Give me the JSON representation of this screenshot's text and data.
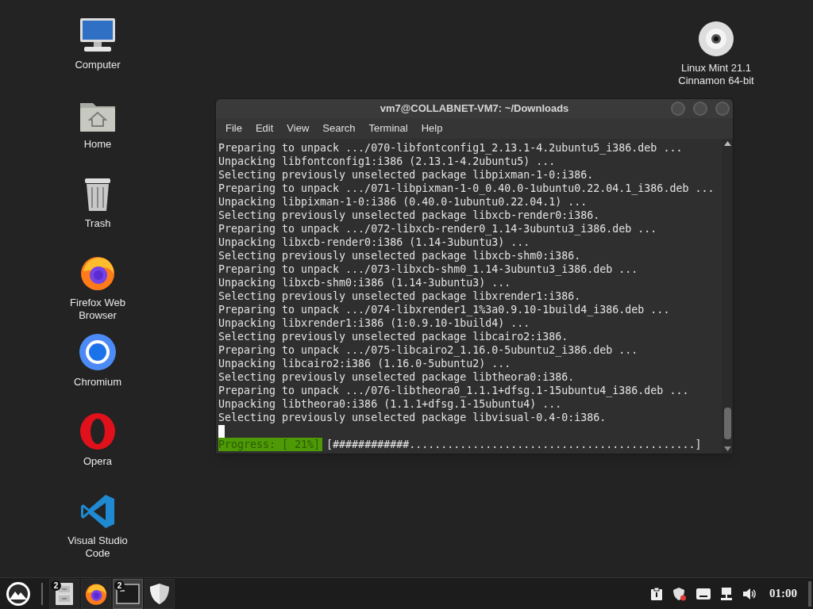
{
  "desktop_icons": [
    {
      "kind": "computer",
      "label": "Computer"
    },
    {
      "kind": "home",
      "label": "Home"
    },
    {
      "kind": "trash",
      "label": "Trash"
    },
    {
      "kind": "firefox",
      "label": "Firefox Web Browser"
    },
    {
      "kind": "chromium",
      "label": "Chromium"
    },
    {
      "kind": "opera",
      "label": "Opera"
    },
    {
      "kind": "vscode",
      "label": "Visual Studio Code"
    }
  ],
  "disc_icon": {
    "kind": "disc",
    "label": "Linux Mint 21.1 Cinnamon 64-bit"
  },
  "terminal": {
    "title": "vm7@COLLABNET-VM7: ~/Downloads",
    "menu": [
      "File",
      "Edit",
      "View",
      "Search",
      "Terminal",
      "Help"
    ],
    "lines": [
      "Preparing to unpack .../070-libfontconfig1_2.13.1-4.2ubuntu5_i386.deb ...",
      "Unpacking libfontconfig1:i386 (2.13.1-4.2ubuntu5) ...",
      "Selecting previously unselected package libpixman-1-0:i386.",
      "Preparing to unpack .../071-libpixman-1-0_0.40.0-1ubuntu0.22.04.1_i386.deb ...",
      "Unpacking libpixman-1-0:i386 (0.40.0-1ubuntu0.22.04.1) ...",
      "Selecting previously unselected package libxcb-render0:i386.",
      "Preparing to unpack .../072-libxcb-render0_1.14-3ubuntu3_i386.deb ...",
      "Unpacking libxcb-render0:i386 (1.14-3ubuntu3) ...",
      "Selecting previously unselected package libxcb-shm0:i386.",
      "Preparing to unpack .../073-libxcb-shm0_1.14-3ubuntu3_i386.deb ...",
      "Unpacking libxcb-shm0:i386 (1.14-3ubuntu3) ...",
      "Selecting previously unselected package libxrender1:i386.",
      "Preparing to unpack .../074-libxrender1_1%3a0.9.10-1build4_i386.deb ...",
      "Unpacking libxrender1:i386 (1:0.9.10-1build4) ...",
      "Selecting previously unselected package libcairo2:i386.",
      "Preparing to unpack .../075-libcairo2_1.16.0-5ubuntu2_i386.deb ...",
      "Unpacking libcairo2:i386 (1.16.0-5ubuntu2) ...",
      "Selecting previously unselected package libtheora0:i386.",
      "Preparing to unpack .../076-libtheora0_1.1.1+dfsg.1-15ubuntu4_i386.deb ...",
      "Unpacking libtheora0:i386 (1.1.1+dfsg.1-15ubuntu4) ...",
      "Selecting previously unselected package libvisual-0.4-0:i386."
    ],
    "progress_label": "Progress: [ 21%]",
    "progress_bar": "[############.............................................]"
  },
  "taskbar": {
    "items": [
      {
        "kind": "files",
        "badge": "2",
        "active": false
      },
      {
        "kind": "firefox",
        "active": false
      },
      {
        "kind": "terminal",
        "badge": "2",
        "active": true
      },
      {
        "kind": "shield",
        "active": false
      }
    ],
    "tray": [
      {
        "kind": "clipboard"
      },
      {
        "kind": "shield-alert"
      },
      {
        "kind": "keyboard"
      },
      {
        "kind": "network"
      },
      {
        "kind": "volume"
      }
    ],
    "clock": "01:00"
  }
}
